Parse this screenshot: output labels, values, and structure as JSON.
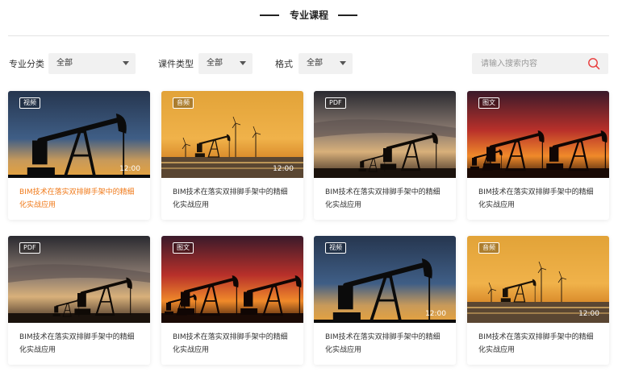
{
  "header": {
    "title": "专业课程"
  },
  "filters": {
    "category": {
      "label": "专业分类",
      "value": "全部"
    },
    "type": {
      "label": "课件类型",
      "value": "全部"
    },
    "format": {
      "label": "格式",
      "value": "全部"
    }
  },
  "search": {
    "placeholder": "请输入搜索内容",
    "value": ""
  },
  "colors": {
    "accent": "#f07a1a",
    "search_icon": "#e83a3a"
  },
  "courses": [
    {
      "badge": "视频",
      "duration": "12:00",
      "title": "BIM技术在落实双排脚手架中的精细化实战应用",
      "scene": "blue",
      "active": true
    },
    {
      "badge": "音频",
      "duration": "12:00",
      "title": "BIM技术在落实双排脚手架中的精细化实战应用",
      "scene": "golden",
      "active": false
    },
    {
      "badge": "PDF",
      "duration": "",
      "title": "BIM技术在落实双排脚手架中的精细化实战应用",
      "scene": "dusk",
      "active": false
    },
    {
      "badge": "图文",
      "duration": "",
      "title": "BIM技术在落实双排脚手架中的精细化实战应用",
      "scene": "red",
      "active": false
    },
    {
      "badge": "PDF",
      "duration": "",
      "title": "BIM技术在落实双排脚手架中的精细化实战应用",
      "scene": "dusk",
      "active": false
    },
    {
      "badge": "图文",
      "duration": "",
      "title": "BIM技术在落实双排脚手架中的精细化实战应用",
      "scene": "red",
      "active": false
    },
    {
      "badge": "视频",
      "duration": "12:00",
      "title": "BIM技术在落实双排脚手架中的精细化实战应用",
      "scene": "blue",
      "active": false
    },
    {
      "badge": "音频",
      "duration": "12:00",
      "title": "BIM技术在落实双排脚手架中的精细化实战应用",
      "scene": "golden",
      "active": false
    }
  ]
}
